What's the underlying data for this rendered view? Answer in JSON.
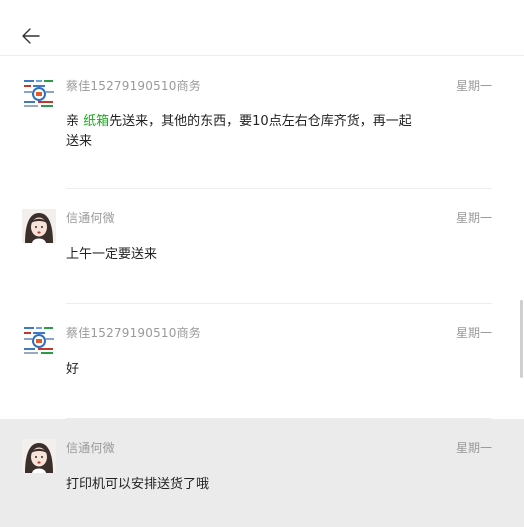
{
  "header": {
    "back_icon": "arrow-left-icon"
  },
  "messages": [
    {
      "name": "蔡佳15279190510商务",
      "time": "星期一",
      "text_before": "亲 ",
      "text_highlight": "纸箱",
      "text_after": "先送来，其他的东西，要10点左右仓库齐货，再一起送来",
      "avatar": "qr-code-icon"
    },
    {
      "name": "信通何微",
      "time": "星期一",
      "text": "上午一定要送来",
      "avatar": "girl-avatar"
    },
    {
      "name": "蔡佳15279190510商务",
      "time": "星期一",
      "text": "好",
      "avatar": "qr-code-icon"
    },
    {
      "name": "信通何微",
      "time": "星期一",
      "text": "打印机可以安排送货了哦",
      "avatar": "girl-avatar"
    }
  ],
  "colors": {
    "highlight": "#1aad19",
    "active_row": "#ebebeb"
  }
}
